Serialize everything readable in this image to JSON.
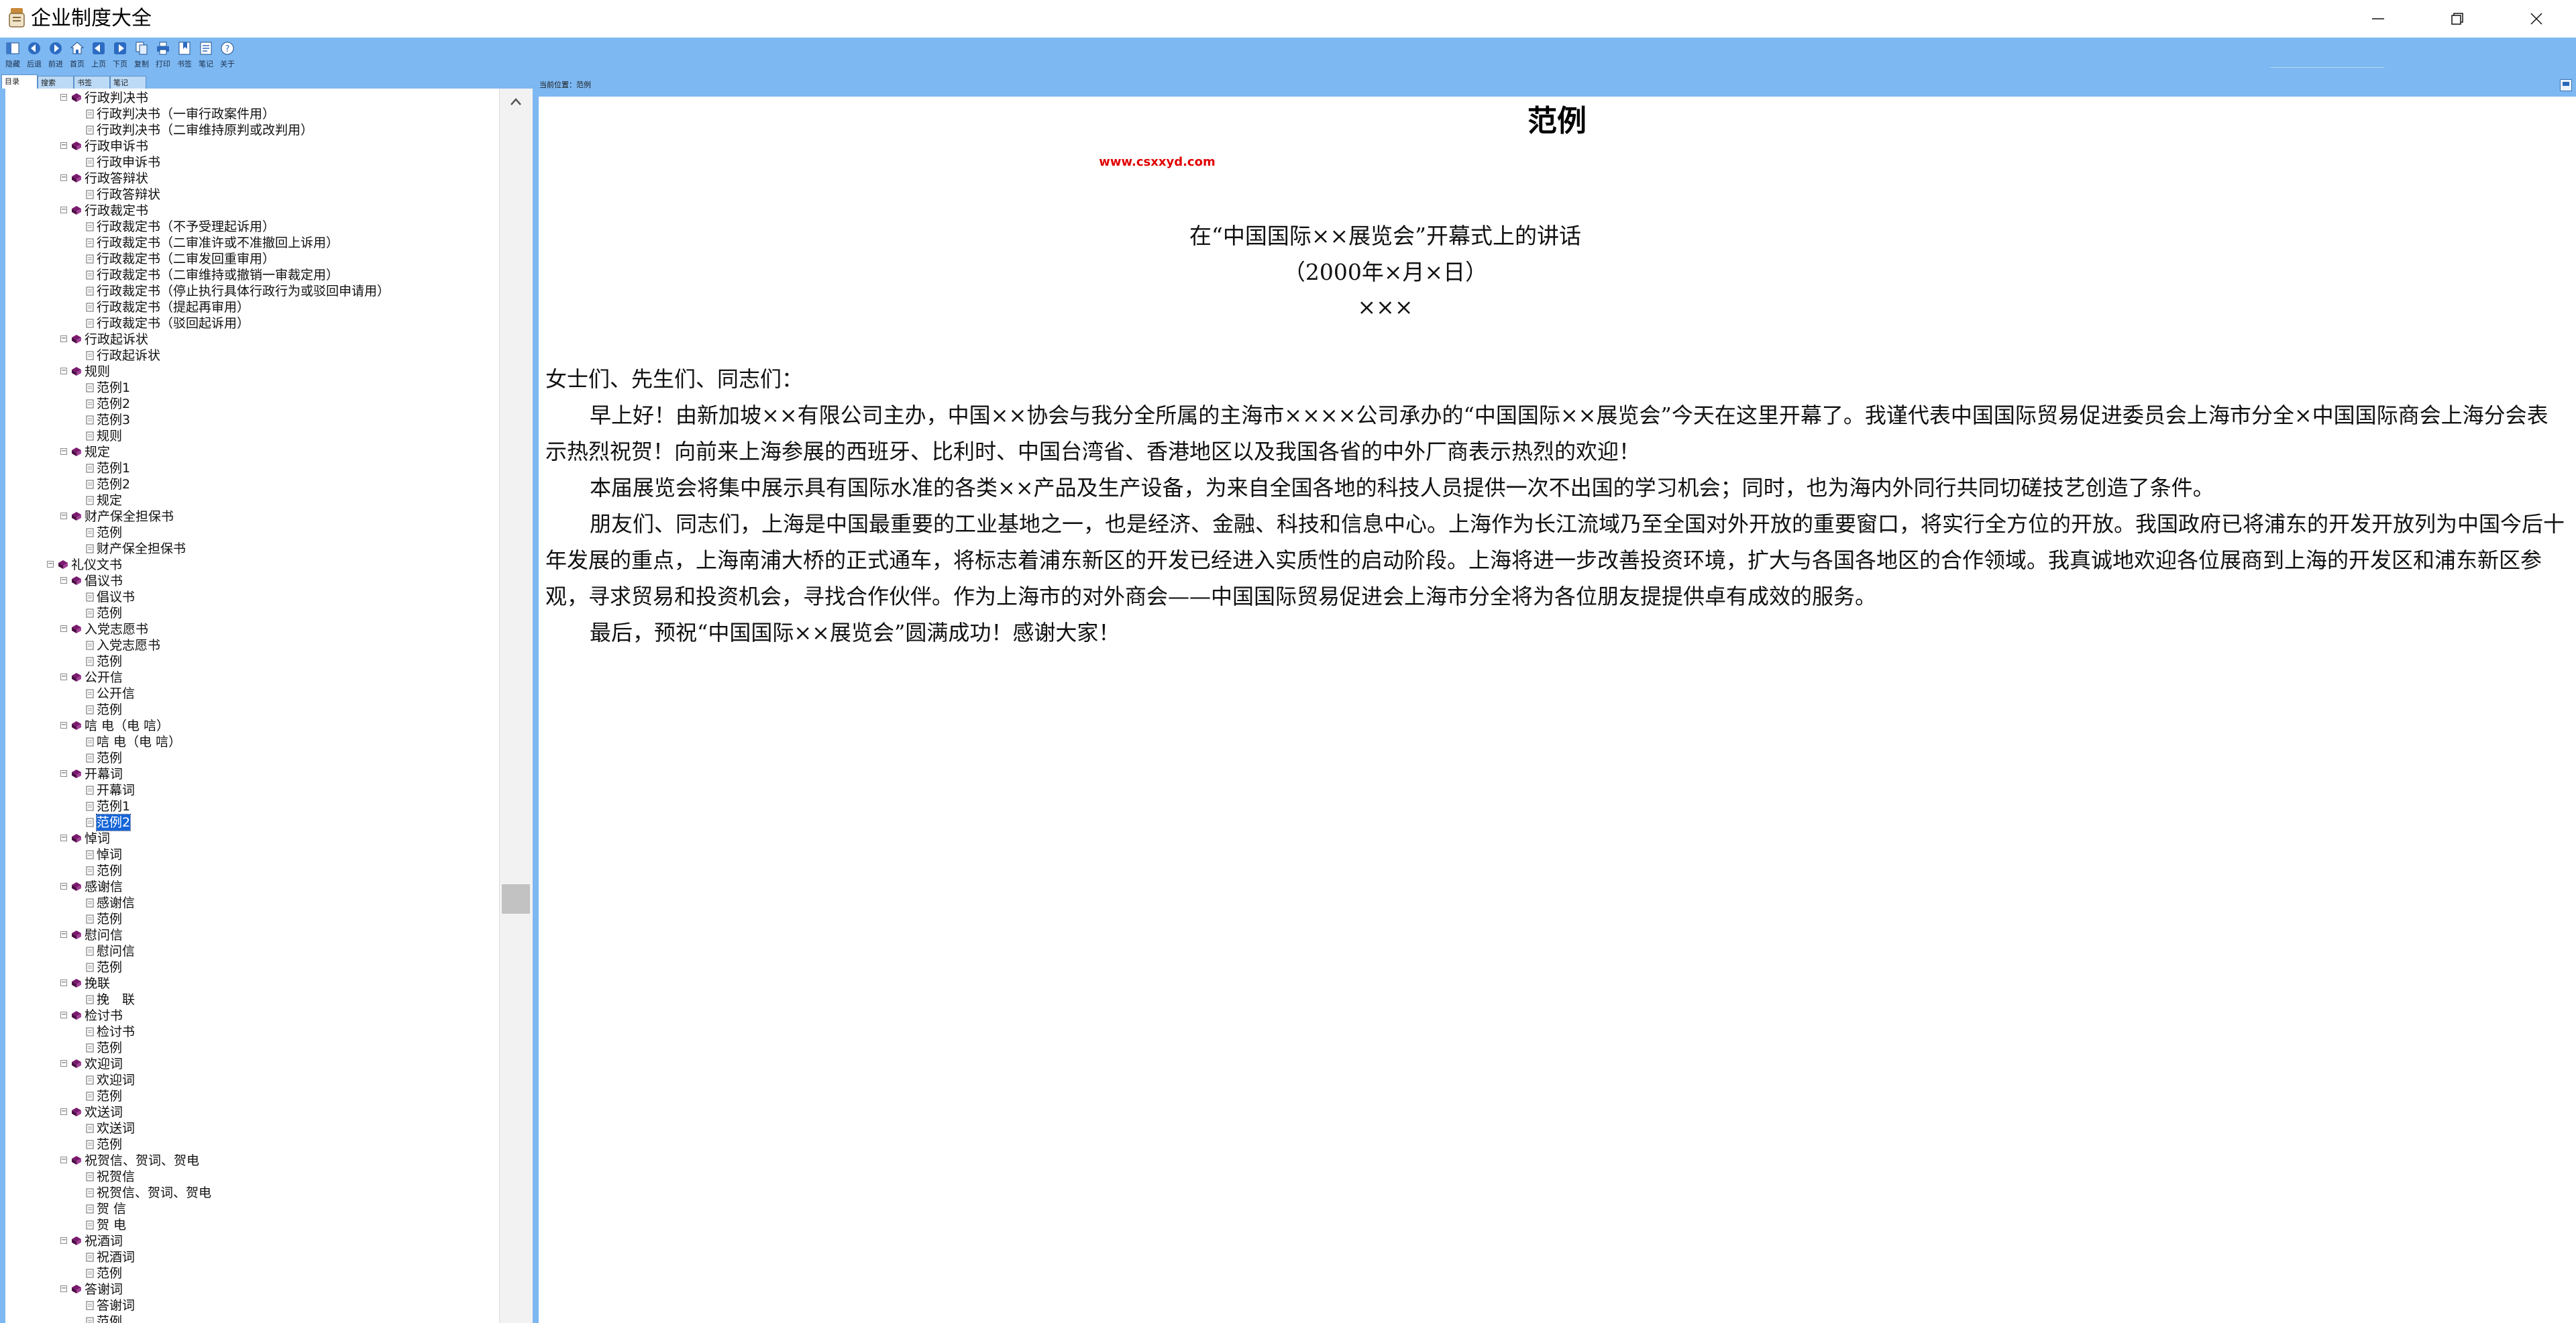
{
  "window": {
    "title": "企业制度大全",
    "controls": [
      "minimize-icon",
      "restore-icon",
      "close-icon"
    ]
  },
  "toolbar": {
    "buttons": [
      "隐藏",
      "后退",
      "前进",
      "首页",
      "上页",
      "下页",
      "复制",
      "打印",
      "书签",
      "笔记",
      "关于"
    ]
  },
  "tabs": [
    "目录",
    "搜索",
    "书签",
    "笔记"
  ],
  "tree": {
    "rows": [
      {
        "label": "行政判决书",
        "type": "folder",
        "level": 1
      },
      {
        "label": "行政判决书（一审行政案件用）",
        "type": "leaf",
        "level": 2
      },
      {
        "label": "行政判决书（二审维持原判或改判用）",
        "type": "leaf",
        "level": 2
      },
      {
        "label": "行政申诉书",
        "type": "folder",
        "level": 1
      },
      {
        "label": "行政申诉书",
        "type": "leaf",
        "level": 2
      },
      {
        "label": "行政答辩状",
        "type": "folder",
        "level": 1
      },
      {
        "label": "行政答辩状",
        "type": "leaf",
        "level": 2
      },
      {
        "label": "行政裁定书",
        "type": "folder",
        "level": 1
      },
      {
        "label": "行政裁定书（不予受理起诉用）",
        "type": "leaf",
        "level": 2
      },
      {
        "label": "行政裁定书（二审准许或不准撤回上诉用）",
        "type": "leaf",
        "level": 2
      },
      {
        "label": "行政裁定书（二审发回重审用）",
        "type": "leaf",
        "level": 2
      },
      {
        "label": "行政裁定书（二审维持或撤销一审裁定用）",
        "type": "leaf",
        "level": 2
      },
      {
        "label": "行政裁定书（停止执行具体行政行为或驳回申请用）",
        "type": "leaf",
        "level": 2
      },
      {
        "label": "行政裁定书（提起再审用）",
        "type": "leaf",
        "level": 2
      },
      {
        "label": "行政裁定书（驳回起诉用）",
        "type": "leaf",
        "level": 2
      },
      {
        "label": "行政起诉状",
        "type": "folder",
        "level": 1
      },
      {
        "label": "行政起诉状",
        "type": "leaf",
        "level": 2
      },
      {
        "label": "规则",
        "type": "folder",
        "level": 1
      },
      {
        "label": "范例1",
        "type": "leaf",
        "level": 2
      },
      {
        "label": "范例2",
        "type": "leaf",
        "level": 2
      },
      {
        "label": "范例3",
        "type": "leaf",
        "level": 2
      },
      {
        "label": "规则",
        "type": "leaf",
        "level": 2
      },
      {
        "label": "规定",
        "type": "folder",
        "level": 1
      },
      {
        "label": "范例1",
        "type": "leaf",
        "level": 2
      },
      {
        "label": "范例2",
        "type": "leaf",
        "level": 2
      },
      {
        "label": "规定",
        "type": "leaf",
        "level": 2
      },
      {
        "label": "财产保全担保书",
        "type": "folder",
        "level": 1
      },
      {
        "label": "范例",
        "type": "leaf",
        "level": 2
      },
      {
        "label": "财产保全担保书",
        "type": "leaf",
        "level": 2
      },
      {
        "label": "礼仪文书",
        "type": "folder",
        "level": 0
      },
      {
        "label": "倡议书",
        "type": "folder",
        "level": 1
      },
      {
        "label": "倡议书",
        "type": "leaf",
        "level": 2
      },
      {
        "label": "范例",
        "type": "leaf",
        "level": 2
      },
      {
        "label": "入党志愿书",
        "type": "folder",
        "level": 1
      },
      {
        "label": "入党志愿书",
        "type": "leaf",
        "level": 2
      },
      {
        "label": "范例",
        "type": "leaf",
        "level": 2
      },
      {
        "label": "公开信",
        "type": "folder",
        "level": 1
      },
      {
        "label": "公开信",
        "type": "leaf",
        "level": 2
      },
      {
        "label": "范例",
        "type": "leaf",
        "level": 2
      },
      {
        "label": "唁 电（电 唁）",
        "type": "folder",
        "level": 1
      },
      {
        "label": "唁 电（电 唁）",
        "type": "leaf",
        "level": 2
      },
      {
        "label": "范例",
        "type": "leaf",
        "level": 2
      },
      {
        "label": "开幕词",
        "type": "folder",
        "level": 1
      },
      {
        "label": "开幕词",
        "type": "leaf",
        "level": 2
      },
      {
        "label": "范例1",
        "type": "leaf",
        "level": 2
      },
      {
        "label": "范例2",
        "type": "leaf",
        "level": 2,
        "selected": true
      },
      {
        "label": "悼词",
        "type": "folder",
        "level": 1
      },
      {
        "label": "悼词",
        "type": "leaf",
        "level": 2
      },
      {
        "label": "范例",
        "type": "leaf",
        "level": 2
      },
      {
        "label": "感谢信",
        "type": "folder",
        "level": 1
      },
      {
        "label": "感谢信",
        "type": "leaf",
        "level": 2
      },
      {
        "label": "范例",
        "type": "leaf",
        "level": 2
      },
      {
        "label": "慰问信",
        "type": "folder",
        "level": 1
      },
      {
        "label": "慰问信",
        "type": "leaf",
        "level": 2
      },
      {
        "label": "范例",
        "type": "leaf",
        "level": 2
      },
      {
        "label": "挽联",
        "type": "folder",
        "level": 1
      },
      {
        "label": "挽　联",
        "type": "leaf",
        "level": 2
      },
      {
        "label": "检讨书",
        "type": "folder",
        "level": 1
      },
      {
        "label": "检讨书",
        "type": "leaf",
        "level": 2
      },
      {
        "label": "范例",
        "type": "leaf",
        "level": 2
      },
      {
        "label": "欢迎词",
        "type": "folder",
        "level": 1
      },
      {
        "label": "欢迎词",
        "type": "leaf",
        "level": 2
      },
      {
        "label": "范例",
        "type": "leaf",
        "level": 2
      },
      {
        "label": "欢送词",
        "type": "folder",
        "level": 1
      },
      {
        "label": "欢送词",
        "type": "leaf",
        "level": 2
      },
      {
        "label": "范例",
        "type": "leaf",
        "level": 2
      },
      {
        "label": "祝贺信、贺词、贺电",
        "type": "folder",
        "level": 1
      },
      {
        "label": "祝贺信",
        "type": "leaf",
        "level": 2
      },
      {
        "label": "祝贺信、贺词、贺电",
        "type": "leaf",
        "level": 2
      },
      {
        "label": "贺 信",
        "type": "leaf",
        "level": 2
      },
      {
        "label": "贺 电",
        "type": "leaf",
        "level": 2
      },
      {
        "label": "祝酒词",
        "type": "folder",
        "level": 1
      },
      {
        "label": "祝酒词",
        "type": "leaf",
        "level": 2
      },
      {
        "label": "范例",
        "type": "leaf",
        "level": 2
      },
      {
        "label": "答谢词",
        "type": "folder",
        "level": 1
      },
      {
        "label": "答谢词",
        "type": "leaf",
        "level": 2
      },
      {
        "label": "范例",
        "type": "leaf",
        "level": 2
      }
    ]
  },
  "breadcrumb": "当前位置：范例",
  "document": {
    "title": "范例",
    "site": "www.csxxyd.com",
    "speech_title": "在“中国国际××展览会”开幕式上的讲话",
    "date": "（2000年×月×日）",
    "author": "×××",
    "salutation": "女士们、先生们、同志们：",
    "paragraphs": [
      "早上好！由新加坡××有限公司主办，中国××协会与我分全所属的主海市××××公司承办的“中国国际××展览会”今天在这里开幕了。我谨代表中国国际贸易促进委员会上海市分全×中国国际商会上海分会表示热烈祝贺！向前来上海参展的西班牙、比利时、中国台湾省、香港地区以及我国各省的中外厂商表示热烈的欢迎！",
      "本届展览会将集中展示具有国际水准的各类××产品及生产设备，为来自全国各地的科技人员提供一次不出国的学习机会；同时，也为海内外同行共同切磋技艺创造了条件。",
      "朋友们、同志们，上海是中国最重要的工业基地之一，也是经济、金融、科技和信息中心。上海作为长江流域乃至全国对外开放的重要窗口，将实行全方位的开放。我国政府已将浦东的开发开放列为中国今后十年发展的重点，上海南浦大桥的正式通车，将标志着浦东新区的开发已经进入实质性的启动阶段。上海将进一步改善投资环境，扩大与各国各地区的合作领域。我真诚地欢迎各位展商到上海的开发区和浦东新区参观，寻求贸易和投资机会，寻找合作伙伴。作为上海市的对外商会——中国国际贸易促进会上海市分全将为各位朋友提提供卓有成效的服务。",
      "最后，预祝“中国国际××展览会”圆满成功！感谢大家！"
    ]
  },
  "colors": {
    "toolbar_bg": "#7db8f2",
    "selection": "#1565d8",
    "site_red": "#e00000",
    "book_icon": "#7a1a6e"
  }
}
